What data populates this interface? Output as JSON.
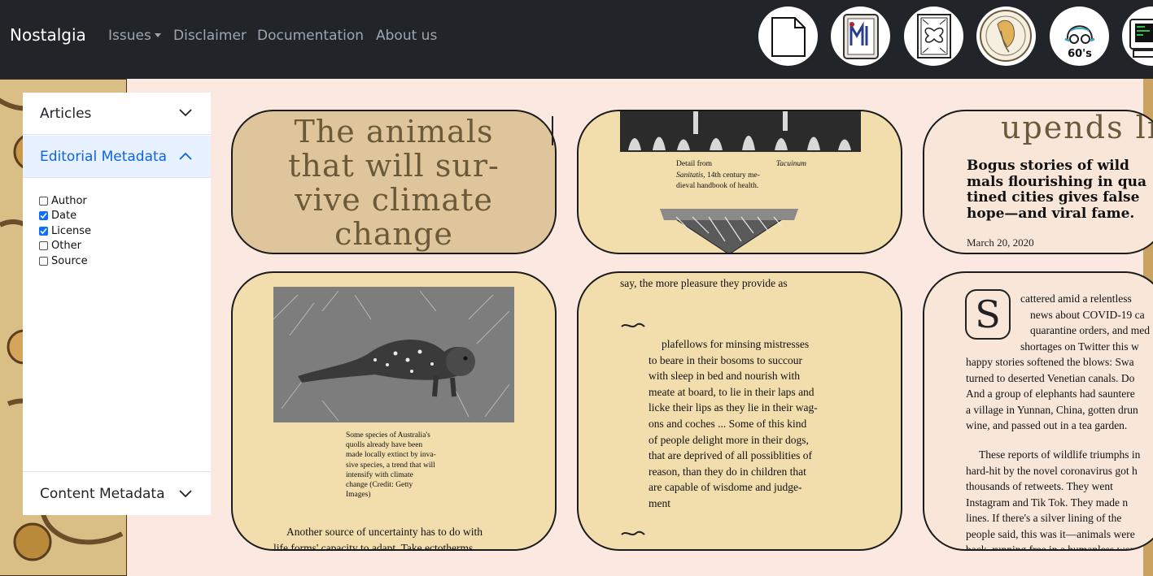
{
  "nav": {
    "brand": "Nostalgia",
    "links": [
      "Issues",
      "Disclaimer",
      "Documentation",
      "About us"
    ],
    "issue_icons": [
      "blank-page-icon",
      "art-nouveau-letter-m-icon",
      "ornamental-butterfly-icon",
      "art-nouveau-portrait-icon",
      "sixties-face-icon",
      "retro-computer-icon"
    ],
    "sixties_label": "60's"
  },
  "sidebar": {
    "sections": [
      "Articles",
      "Editorial Metadata",
      "Content Metadata"
    ],
    "editorial_options": [
      {
        "label": "Author",
        "checked": false
      },
      {
        "label": "Date",
        "checked": true
      },
      {
        "label": "License",
        "checked": true
      },
      {
        "label": "Other",
        "checked": false
      },
      {
        "label": "Source",
        "checked": false
      }
    ]
  },
  "cards": {
    "title": "The animals that will survive climate change",
    "title_lines": [
      "The animals",
      "that will sur-",
      "vive climate",
      "change"
    ],
    "image_caption_1": "Detail from Tacuinum Sanitatis, 14th century medieval handbook of health.",
    "caption1_lines": [
      "Detail from",
      "Tacuinum",
      "Sanitatis, 14th century me-",
      "dieval handbook of health."
    ],
    "headline_fragment": "upends lif",
    "subhead_lines": [
      "Bogus stories of wild",
      "mals flourishing in qua",
      "tined cities gives false",
      "hope—and viral fame."
    ],
    "date": "March 20, 2020",
    "quoll_caption_lines": [
      "Some species of Australia's",
      "quolls already have been",
      "made locally extinct by inva-",
      "sive species, a trend that will",
      "intensify with climate",
      "change (Credit: Getty",
      "Images)"
    ],
    "body_lines_1": [
      "Another source of uncertainty has to do with",
      "life forms' capacity to adapt. Take ectotherms"
    ],
    "quote_intro": "say, the more pleasure they provide as",
    "quote_lines": [
      "plafellows for minsing mistresses",
      "to beare in their bosoms to succour",
      "with sleep in bed and nourish with",
      "meate at board, to lie in their laps and",
      "licke their lips as they lie in their wag-",
      "ons and coches ... Some of this kind",
      "of people delight more in their dogs,",
      "that are deprived of all possiblities of",
      "reason, than they do in children that",
      "are capable of wisdome and judge-",
      "ment"
    ],
    "dropcap": "S",
    "article_lines_a": [
      "cattered amid a relentless",
      "news about COVID-19 ca",
      "quarantine orders, and med",
      "shortages on Twitter this w"
    ],
    "article_lines_b": [
      "happy stories softened the blows: Swa",
      "turned to deserted Venetian canals. Do",
      "And a group of elephants had sauntere",
      "a village in Yunnan, China, gotten drun",
      "wine, and passed out in a tea garden."
    ],
    "article_lines_c": [
      "These reports of wildlife triumphs in",
      "hard-hit by the novel coronavirus got h",
      "thousands of retweets. They went",
      "Instagram and Tik Tok. They made n",
      "lines. If there's a silver lining of the",
      "people said, this was it—animals were",
      "back, running free in a humanless wor"
    ]
  }
}
